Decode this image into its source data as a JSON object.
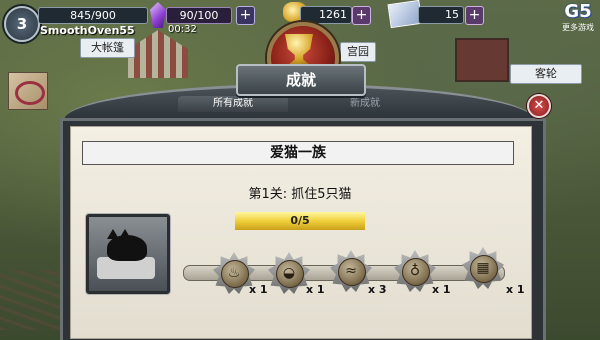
{
  "hud": {
    "level": "3",
    "xp": "845/900",
    "username": "SmoothOven55",
    "energy": "90/100",
    "energy_timer": "00:32",
    "coins": "1261",
    "cards": "15",
    "plus": "+",
    "brand": "G5",
    "more_games": "更多游戏"
  },
  "locations": {
    "left": "大帐篷",
    "mid": "宫园",
    "right": "客轮"
  },
  "banner": {
    "title": "成就"
  },
  "tabs": [
    {
      "label": "所有成就",
      "active": true
    },
    {
      "label": "新成就",
      "active": false
    }
  ],
  "achievement": {
    "name": "爱猫一族",
    "stage": "第1关: 抓住5只猫",
    "progress": "0/5",
    "progress_fraction": 0.0
  },
  "rewards": [
    {
      "icon": "bell-icon",
      "glyph": "♨",
      "mult": "x 1"
    },
    {
      "icon": "slipper-icon",
      "glyph": "◒",
      "mult": "x 1"
    },
    {
      "icon": "fish-icon",
      "glyph": "≈",
      "mult": "x 3"
    },
    {
      "icon": "lamp-icon",
      "glyph": "♁",
      "mult": "x 1"
    },
    {
      "icon": "frame-icon",
      "glyph": "▦",
      "mult": "x 1"
    }
  ],
  "close": "✕"
}
